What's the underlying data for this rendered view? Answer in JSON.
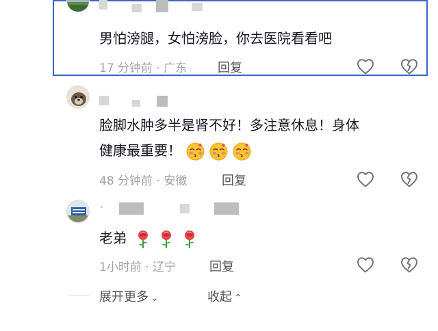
{
  "comments": [
    {
      "text": "男怕滂腿，女怕滂脸，你去医院看看吧",
      "time": "17 分钟前",
      "location": "广东",
      "reply_label": "回复"
    },
    {
      "text_line1": "脸脚水肿多半是肾不好！多注意休息！身体",
      "text_line2": "健康最重要！",
      "time": "48 分钟前",
      "location": "安徽",
      "reply_label": "回复",
      "emoji": "blushing-kiss-emoji"
    },
    {
      "text": "老弟",
      "time": "1小时前",
      "location": "辽宁",
      "reply_label": "回复",
      "emoji": "rose-emoji"
    }
  ],
  "separator": "·",
  "footer": {
    "expand_more_label": "展开更多",
    "collapse_label": "收起"
  },
  "colors": {
    "highlight_border": "#3f63c2",
    "meta_text": "#a1a2a6",
    "body_text": "#161823"
  },
  "icons": [
    "heart-outline-icon",
    "broken-heart-outline-icon",
    "chevron-down-icon",
    "chevron-up-icon"
  ]
}
